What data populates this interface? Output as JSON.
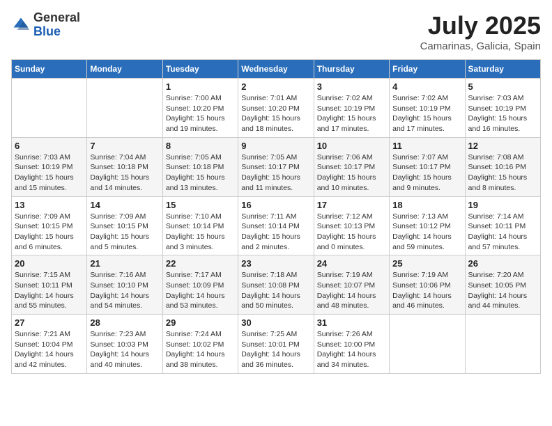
{
  "header": {
    "logo_general": "General",
    "logo_blue": "Blue",
    "month_title": "July 2025",
    "location": "Camarinas, Galicia, Spain"
  },
  "days_of_week": [
    "Sunday",
    "Monday",
    "Tuesday",
    "Wednesday",
    "Thursday",
    "Friday",
    "Saturday"
  ],
  "weeks": [
    [
      {
        "day": "",
        "info": ""
      },
      {
        "day": "",
        "info": ""
      },
      {
        "day": "1",
        "info": "Sunrise: 7:00 AM\nSunset: 10:20 PM\nDaylight: 15 hours\nand 19 minutes."
      },
      {
        "day": "2",
        "info": "Sunrise: 7:01 AM\nSunset: 10:20 PM\nDaylight: 15 hours\nand 18 minutes."
      },
      {
        "day": "3",
        "info": "Sunrise: 7:02 AM\nSunset: 10:19 PM\nDaylight: 15 hours\nand 17 minutes."
      },
      {
        "day": "4",
        "info": "Sunrise: 7:02 AM\nSunset: 10:19 PM\nDaylight: 15 hours\nand 17 minutes."
      },
      {
        "day": "5",
        "info": "Sunrise: 7:03 AM\nSunset: 10:19 PM\nDaylight: 15 hours\nand 16 minutes."
      }
    ],
    [
      {
        "day": "6",
        "info": "Sunrise: 7:03 AM\nSunset: 10:19 PM\nDaylight: 15 hours\nand 15 minutes."
      },
      {
        "day": "7",
        "info": "Sunrise: 7:04 AM\nSunset: 10:18 PM\nDaylight: 15 hours\nand 14 minutes."
      },
      {
        "day": "8",
        "info": "Sunrise: 7:05 AM\nSunset: 10:18 PM\nDaylight: 15 hours\nand 13 minutes."
      },
      {
        "day": "9",
        "info": "Sunrise: 7:05 AM\nSunset: 10:17 PM\nDaylight: 15 hours\nand 11 minutes."
      },
      {
        "day": "10",
        "info": "Sunrise: 7:06 AM\nSunset: 10:17 PM\nDaylight: 15 hours\nand 10 minutes."
      },
      {
        "day": "11",
        "info": "Sunrise: 7:07 AM\nSunset: 10:17 PM\nDaylight: 15 hours\nand 9 minutes."
      },
      {
        "day": "12",
        "info": "Sunrise: 7:08 AM\nSunset: 10:16 PM\nDaylight: 15 hours\nand 8 minutes."
      }
    ],
    [
      {
        "day": "13",
        "info": "Sunrise: 7:09 AM\nSunset: 10:15 PM\nDaylight: 15 hours\nand 6 minutes."
      },
      {
        "day": "14",
        "info": "Sunrise: 7:09 AM\nSunset: 10:15 PM\nDaylight: 15 hours\nand 5 minutes."
      },
      {
        "day": "15",
        "info": "Sunrise: 7:10 AM\nSunset: 10:14 PM\nDaylight: 15 hours\nand 3 minutes."
      },
      {
        "day": "16",
        "info": "Sunrise: 7:11 AM\nSunset: 10:14 PM\nDaylight: 15 hours\nand 2 minutes."
      },
      {
        "day": "17",
        "info": "Sunrise: 7:12 AM\nSunset: 10:13 PM\nDaylight: 15 hours\nand 0 minutes."
      },
      {
        "day": "18",
        "info": "Sunrise: 7:13 AM\nSunset: 10:12 PM\nDaylight: 14 hours\nand 59 minutes."
      },
      {
        "day": "19",
        "info": "Sunrise: 7:14 AM\nSunset: 10:11 PM\nDaylight: 14 hours\nand 57 minutes."
      }
    ],
    [
      {
        "day": "20",
        "info": "Sunrise: 7:15 AM\nSunset: 10:11 PM\nDaylight: 14 hours\nand 55 minutes."
      },
      {
        "day": "21",
        "info": "Sunrise: 7:16 AM\nSunset: 10:10 PM\nDaylight: 14 hours\nand 54 minutes."
      },
      {
        "day": "22",
        "info": "Sunrise: 7:17 AM\nSunset: 10:09 PM\nDaylight: 14 hours\nand 53 minutes."
      },
      {
        "day": "23",
        "info": "Sunrise: 7:18 AM\nSunset: 10:08 PM\nDaylight: 14 hours\nand 50 minutes."
      },
      {
        "day": "24",
        "info": "Sunrise: 7:19 AM\nSunset: 10:07 PM\nDaylight: 14 hours\nand 48 minutes."
      },
      {
        "day": "25",
        "info": "Sunrise: 7:19 AM\nSunset: 10:06 PM\nDaylight: 14 hours\nand 46 minutes."
      },
      {
        "day": "26",
        "info": "Sunrise: 7:20 AM\nSunset: 10:05 PM\nDaylight: 14 hours\nand 44 minutes."
      }
    ],
    [
      {
        "day": "27",
        "info": "Sunrise: 7:21 AM\nSunset: 10:04 PM\nDaylight: 14 hours\nand 42 minutes."
      },
      {
        "day": "28",
        "info": "Sunrise: 7:23 AM\nSunset: 10:03 PM\nDaylight: 14 hours\nand 40 minutes."
      },
      {
        "day": "29",
        "info": "Sunrise: 7:24 AM\nSunset: 10:02 PM\nDaylight: 14 hours\nand 38 minutes."
      },
      {
        "day": "30",
        "info": "Sunrise: 7:25 AM\nSunset: 10:01 PM\nDaylight: 14 hours\nand 36 minutes."
      },
      {
        "day": "31",
        "info": "Sunrise: 7:26 AM\nSunset: 10:00 PM\nDaylight: 14 hours\nand 34 minutes."
      },
      {
        "day": "",
        "info": ""
      },
      {
        "day": "",
        "info": ""
      }
    ]
  ]
}
